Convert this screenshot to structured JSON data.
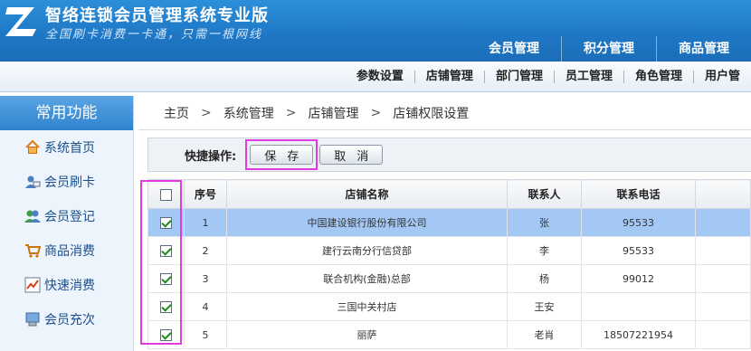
{
  "header": {
    "title": "智络连锁会员管理系统专业版",
    "slogan": "全国刷卡消费一卡通，只需一根网线",
    "main_nav": [
      "会员管理",
      "积分管理",
      "商品管理"
    ]
  },
  "sub_nav": [
    "参数设置",
    "店铺管理",
    "部门管理",
    "员工管理",
    "角色管理",
    "用户管"
  ],
  "sidebar": {
    "title": "常用功能",
    "items": [
      {
        "label": "系统首页",
        "icon": "home-icon"
      },
      {
        "label": "会员刷卡",
        "icon": "member-card-icon"
      },
      {
        "label": "会员登记",
        "icon": "member-register-icon"
      },
      {
        "label": "商品消费",
        "icon": "cart-icon"
      },
      {
        "label": "快速消费",
        "icon": "chart-icon"
      },
      {
        "label": "会员充次",
        "icon": "recharge-icon"
      }
    ]
  },
  "breadcrumb": [
    "主页",
    "系统管理",
    "店铺管理",
    "店铺权限设置"
  ],
  "breadcrumb_sep": ">",
  "quick": {
    "label": "快捷操作:",
    "save": "保存",
    "cancel": "取消"
  },
  "table": {
    "headers": {
      "no": "序号",
      "name": "店铺名称",
      "contact": "联系人",
      "phone": "联系电话"
    },
    "rows": [
      {
        "no": "1",
        "name": "中国建设银行股份有限公司",
        "contact": "张",
        "phone": "95533",
        "checked": true,
        "selected": true
      },
      {
        "no": "2",
        "name": "建行云南分行信贷部",
        "contact": "李",
        "phone": "95533",
        "checked": true,
        "selected": false
      },
      {
        "no": "3",
        "name": "联合机构(金融)总部",
        "contact": "杨",
        "phone": "99012",
        "checked": true,
        "selected": false
      },
      {
        "no": "4",
        "name": "三国中关村店",
        "contact": "王安",
        "phone": "",
        "checked": true,
        "selected": false
      },
      {
        "no": "5",
        "name": "丽萨",
        "contact": "老肖",
        "phone": "18507221954",
        "checked": true,
        "selected": false
      }
    ]
  },
  "colors": {
    "header_blue": "#1f78c6",
    "highlight_magenta": "#e13ae0",
    "selected_row": "#a4c8f4"
  }
}
